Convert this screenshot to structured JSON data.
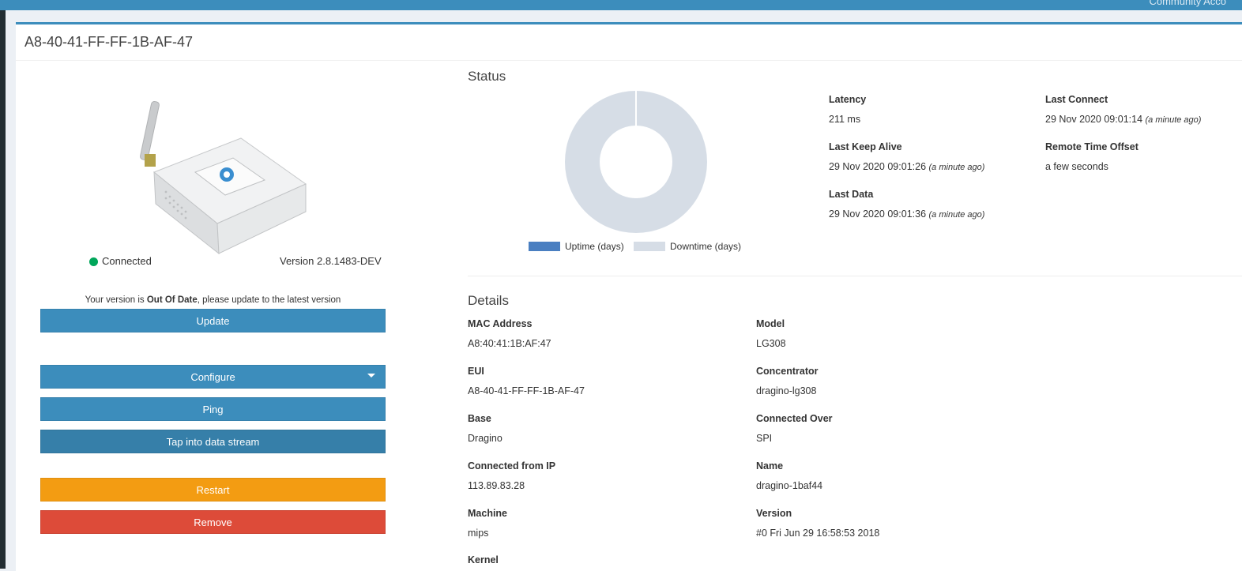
{
  "topbar": {
    "account": "Community Acco"
  },
  "page": {
    "title": "A8-40-41-FF-FF-1B-AF-47"
  },
  "device": {
    "status": "Connected",
    "version": "Version 2.8.1483-DEV",
    "outdated_prefix": "Your version is ",
    "outdated_strong": "Out Of Date",
    "outdated_suffix": ", please update to the latest version"
  },
  "actions": {
    "update": "Update",
    "configure": "Configure",
    "ping": "Ping",
    "tap": "Tap into data stream",
    "restart": "Restart",
    "remove": "Remove"
  },
  "status": {
    "title": "Status",
    "chart_data": {
      "type": "pie",
      "categories": [
        "Uptime (days)",
        "Downtime (days)"
      ],
      "values": [
        0,
        1
      ],
      "colors": [
        "#4a7fc1",
        "#d6dde6"
      ]
    },
    "latency_label": "Latency",
    "latency": "211 ms",
    "last_connect_label": "Last Connect",
    "last_connect": "29 Nov 2020 09:01:14",
    "last_connect_ago": "(a minute ago)",
    "last_keep_alive_label": "Last Keep Alive",
    "last_keep_alive": "29 Nov 2020 09:01:26",
    "last_keep_alive_ago": "(a minute ago)",
    "remote_offset_label": "Remote Time Offset",
    "remote_offset": "a few seconds",
    "last_data_label": "Last Data",
    "last_data": "29 Nov 2020 09:01:36",
    "last_data_ago": "(a minute ago)"
  },
  "details": {
    "title": "Details",
    "mac_label": "MAC Address",
    "mac": "A8:40:41:1B:AF:47",
    "model_label": "Model",
    "model": "LG308",
    "eui_label": "EUI",
    "eui": "A8-40-41-FF-FF-1B-AF-47",
    "concentrator_label": "Concentrator",
    "concentrator": "dragino-lg308",
    "base_label": "Base",
    "base": "Dragino",
    "connected_over_label": "Connected Over",
    "connected_over": "SPI",
    "ip_label": "Connected from IP",
    "ip": "113.89.83.28",
    "name_label": "Name",
    "name": "dragino-1baf44",
    "machine_label": "Machine",
    "machine": "mips",
    "version_label": "Version",
    "version": "#0 Fri Jun 29 16:58:53 2018",
    "kernel_label": "Kernel"
  },
  "colors": {
    "primary": "#3c8dbc",
    "success": "#00a65a",
    "warning": "#f39c12",
    "danger": "#dd4b39"
  }
}
